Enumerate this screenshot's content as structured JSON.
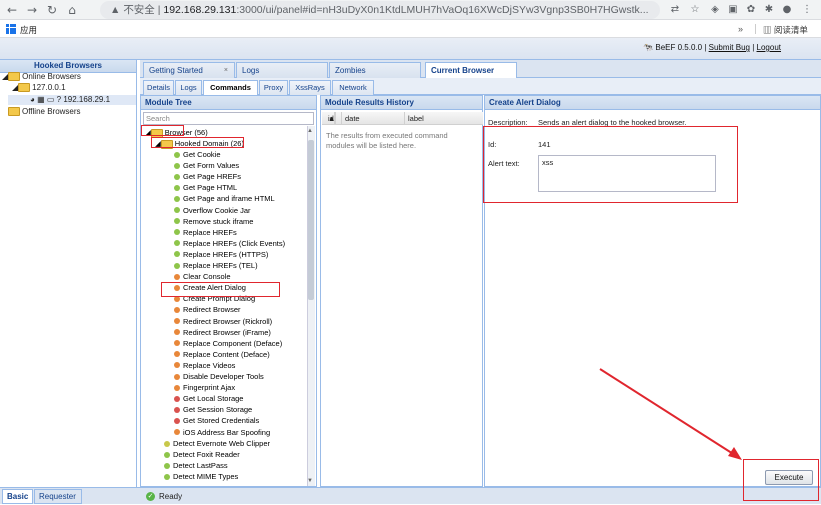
{
  "browser": {
    "security_label": "不安全",
    "url_host": "192.168.29.131",
    "url_path": ":3000/ui/panel#id=nH3uDyX0n1KtdLMUH7hVaOq16XWcDjSYw3Vgnp3SB0H7HGwstk...",
    "bookmark_apps": "应用",
    "bookmark_more": "»",
    "reading_list": "阅读清单"
  },
  "beef": {
    "brand": "BeEF",
    "version": "0.5.0.0",
    "separator": "|",
    "submit_bug": "Submit Bug",
    "logout": "Logout"
  },
  "left": {
    "title": "Hooked Browsers",
    "online": "Online Browsers",
    "host": "127.0.0.1",
    "browser_entry": "? 192.168.29.1",
    "offline": "Offline Browsers"
  },
  "tabs": [
    "Getting Started",
    "Logs",
    "Zombies",
    "Current Browser"
  ],
  "subtabs": [
    "Details",
    "Logs",
    "Commands",
    "Proxy",
    "XssRays",
    "Network"
  ],
  "module_tree": {
    "title": "Module Tree",
    "search_placeholder": "Search",
    "root": "Browser (56)",
    "folder": "Hooked Domain (26)",
    "items": [
      {
        "label": "Get Cookie",
        "c": "g"
      },
      {
        "label": "Get Form Values",
        "c": "g"
      },
      {
        "label": "Get Page HREFs",
        "c": "g"
      },
      {
        "label": "Get Page HTML",
        "c": "g"
      },
      {
        "label": "Get Page and iframe HTML",
        "c": "g"
      },
      {
        "label": "Overflow Cookie Jar",
        "c": "g"
      },
      {
        "label": "Remove stuck iframe",
        "c": "g"
      },
      {
        "label": "Replace HREFs",
        "c": "g"
      },
      {
        "label": "Replace HREFs (Click Events)",
        "c": "g"
      },
      {
        "label": "Replace HREFs (HTTPS)",
        "c": "g"
      },
      {
        "label": "Replace HREFs (TEL)",
        "c": "g"
      },
      {
        "label": "Clear Console",
        "c": "o"
      },
      {
        "label": "Create Alert Dialog",
        "c": "o"
      },
      {
        "label": "Create Prompt Dialog",
        "c": "o"
      },
      {
        "label": "Redirect Browser",
        "c": "o"
      },
      {
        "label": "Redirect Browser (Rickroll)",
        "c": "o"
      },
      {
        "label": "Redirect Browser (iFrame)",
        "c": "o"
      },
      {
        "label": "Replace Component (Deface)",
        "c": "o"
      },
      {
        "label": "Replace Content (Deface)",
        "c": "o"
      },
      {
        "label": "Replace Videos",
        "c": "o"
      },
      {
        "label": "Disable Developer Tools",
        "c": "o"
      },
      {
        "label": "Fingerprint Ajax",
        "c": "o"
      },
      {
        "label": "Get Local Storage",
        "c": "r"
      },
      {
        "label": "Get Session Storage",
        "c": "r"
      },
      {
        "label": "Get Stored Credentials",
        "c": "r"
      },
      {
        "label": "iOS Address Bar Spoofing",
        "c": "o"
      }
    ],
    "outer_items": [
      {
        "label": "Detect Evernote Web Clipper",
        "c": "y"
      },
      {
        "label": "Detect Foxit Reader",
        "c": "g"
      },
      {
        "label": "Detect LastPass",
        "c": "g"
      },
      {
        "label": "Detect MIME Types",
        "c": "g"
      }
    ]
  },
  "results": {
    "title": "Module Results History",
    "col_id": "id",
    "col_date": "date",
    "col_label": "label",
    "empty": "The results from executed command modules will be listed here."
  },
  "alert_dialog": {
    "title": "Create Alert Dialog",
    "description_label": "Description:",
    "description": "Sends an alert dialog to the hooked browser.",
    "id_label": "Id:",
    "id_value": "141",
    "text_label": "Alert text:",
    "text_value": "xss",
    "execute": "Execute"
  },
  "status": {
    "text": "Ready"
  },
  "bottom_tabs": [
    "Basic",
    "Requester"
  ],
  "colors": {
    "annotation_red": "#e0262e",
    "ext_header": "#dbe4f1",
    "ext_border": "#99bbe8"
  }
}
